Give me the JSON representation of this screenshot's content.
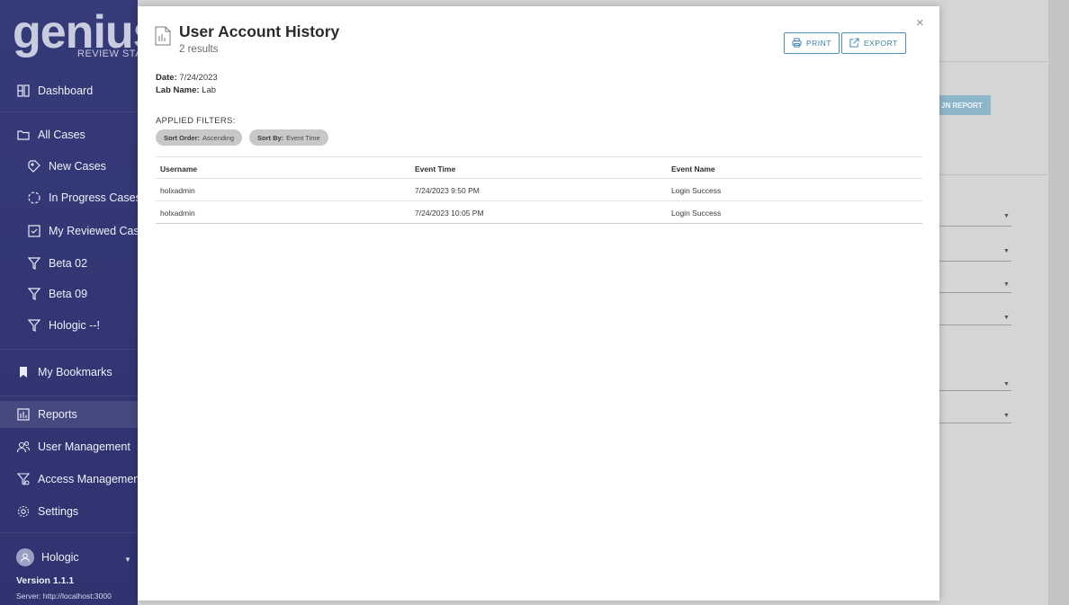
{
  "sidebar": {
    "logo_text": "genius",
    "logo_sub": "REVIEW STATIC",
    "items": [
      {
        "label": "Dashboard",
        "icon": "dashboard-icon"
      },
      {
        "label": "All Cases",
        "icon": "folder-icon"
      },
      {
        "label": "New Cases",
        "icon": "tag-icon"
      },
      {
        "label": "In Progress Cases",
        "icon": "progress-circle-icon"
      },
      {
        "label": "My Reviewed Case",
        "icon": "checkbox-icon"
      },
      {
        "label": "Beta 02",
        "icon": "filter-icon"
      },
      {
        "label": "Beta 09",
        "icon": "filter-icon"
      },
      {
        "label": "Hologic --!",
        "icon": "filter-icon"
      },
      {
        "label": "My Bookmarks",
        "icon": "bookmark-icon"
      },
      {
        "label": "Reports",
        "icon": "report-icon"
      },
      {
        "label": "User Management",
        "icon": "users-icon"
      },
      {
        "label": "Access Management",
        "icon": "access-filter-icon"
      },
      {
        "label": "Settings",
        "icon": "gear-icon"
      }
    ],
    "user_name": "Hologic",
    "version": "Version 1.1.1",
    "server": "Server: http://localhost:3000"
  },
  "background": {
    "run_report_label": "JN REPORT"
  },
  "modal": {
    "title": "User Account History",
    "results": "2 results",
    "print_label": "PRINT",
    "export_label": "EXPORT",
    "close_glyph": "×",
    "date_label": "Date:",
    "date_value": "7/24/2023",
    "lab_label": "Lab Name:",
    "lab_value": "Lab",
    "filters_label": "APPLIED FILTERS:",
    "filters": [
      {
        "key": "Sort Order:",
        "value": "Ascending"
      },
      {
        "key": "Sort By:",
        "value": "Event Time"
      }
    ],
    "table": {
      "headers": [
        "Username",
        "Event Time",
        "Event Name"
      ],
      "rows": [
        [
          "holxadmin",
          "7/24/2023 9:50 PM",
          "Login Success"
        ],
        [
          "holxadmin",
          "7/24/2023 10:05 PM",
          "Login Success"
        ]
      ]
    }
  },
  "colors": {
    "sidebar_bg": "#353a78",
    "accent": "#3a7fa8",
    "chip_bg": "#c8c8c8"
  }
}
